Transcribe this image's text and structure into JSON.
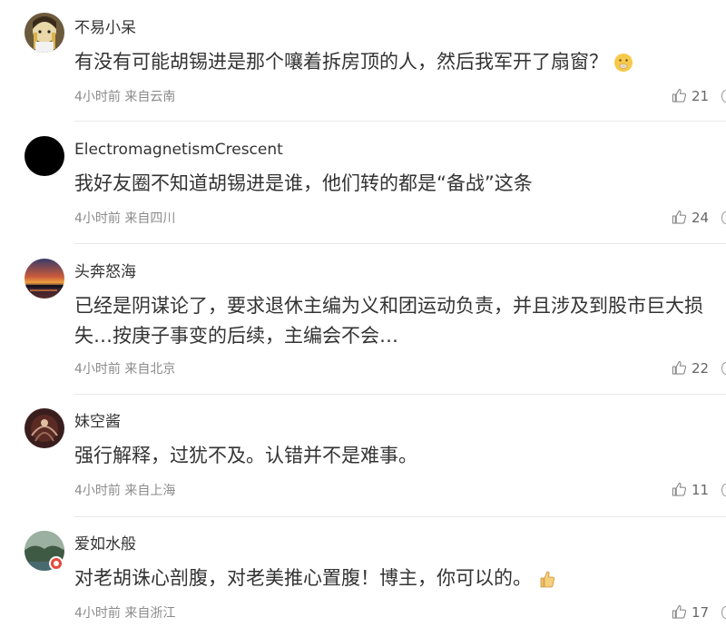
{
  "comments": [
    {
      "username": "不易小呆",
      "text_lines": [
        "有没有可能胡锡进是那个嚷着拆房顶的人，然后我军开了扇窗？"
      ],
      "emoji": "shushing-face-emoji",
      "time": "4小时前",
      "location": "来自云南",
      "likes": "21"
    },
    {
      "username": "ElectromagnetismCrescent",
      "text_lines": [
        "我好友圈不知道胡锡进是谁，他们转的都是“备战”这条"
      ],
      "time": "4小时前",
      "location": "来自四川",
      "likes": "24"
    },
    {
      "username": "头奔怒海",
      "text_lines": [
        "已经是阴谋论了，要求退休主编为义和团运动负责，并且涉及到股市巨大损",
        "失…按庚子事变的后续，主编会不会…"
      ],
      "time": "4小时前",
      "location": "来自北京",
      "likes": "22"
    },
    {
      "username": "妹空酱",
      "text_lines": [
        "强行解释，过犹不及。认错并不是难事。"
      ],
      "time": "4小时前",
      "location": "来自上海",
      "likes": "11"
    },
    {
      "username": "爱如水般",
      "text_lines": [
        "对老胡诛心剖腹，对老美推心置腹！博主，你可以的。"
      ],
      "emoji": "thumbs-up-emoji",
      "time": "4小时前",
      "location": "来自浙江",
      "likes": "17"
    }
  ]
}
